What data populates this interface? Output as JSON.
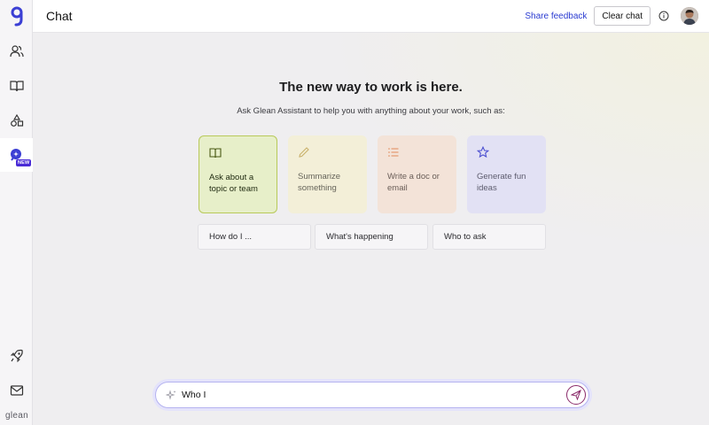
{
  "app": {
    "brand": "glean"
  },
  "header": {
    "title": "Chat",
    "share_feedback": "Share feedback",
    "clear_chat": "Clear chat"
  },
  "sidebar": {
    "new_badge": "NEW"
  },
  "main": {
    "title": "The new way to work is here.",
    "subtitle": "Ask Glean Assistant to help you with anything about your work, such as:",
    "cards": [
      {
        "label": "Ask about a topic or team",
        "icon": "book-icon",
        "color": "#e7efc9"
      },
      {
        "label": "Summarize something",
        "icon": "pencil-icon",
        "color": "#f3efd8"
      },
      {
        "label": "Write a doc or email",
        "icon": "list-icon",
        "color": "#f3e3d8"
      },
      {
        "label": "Generate fun ideas",
        "icon": "star-icon",
        "color": "#e2e1f4"
      }
    ],
    "suggestions": [
      "How do I ...",
      "What's happening",
      "Who to ask"
    ]
  },
  "composer": {
    "value": "Who I"
  },
  "colors": {
    "accent": "#2a3bd1",
    "brand": "#4a2bd6",
    "send": "#8a2a6a"
  }
}
